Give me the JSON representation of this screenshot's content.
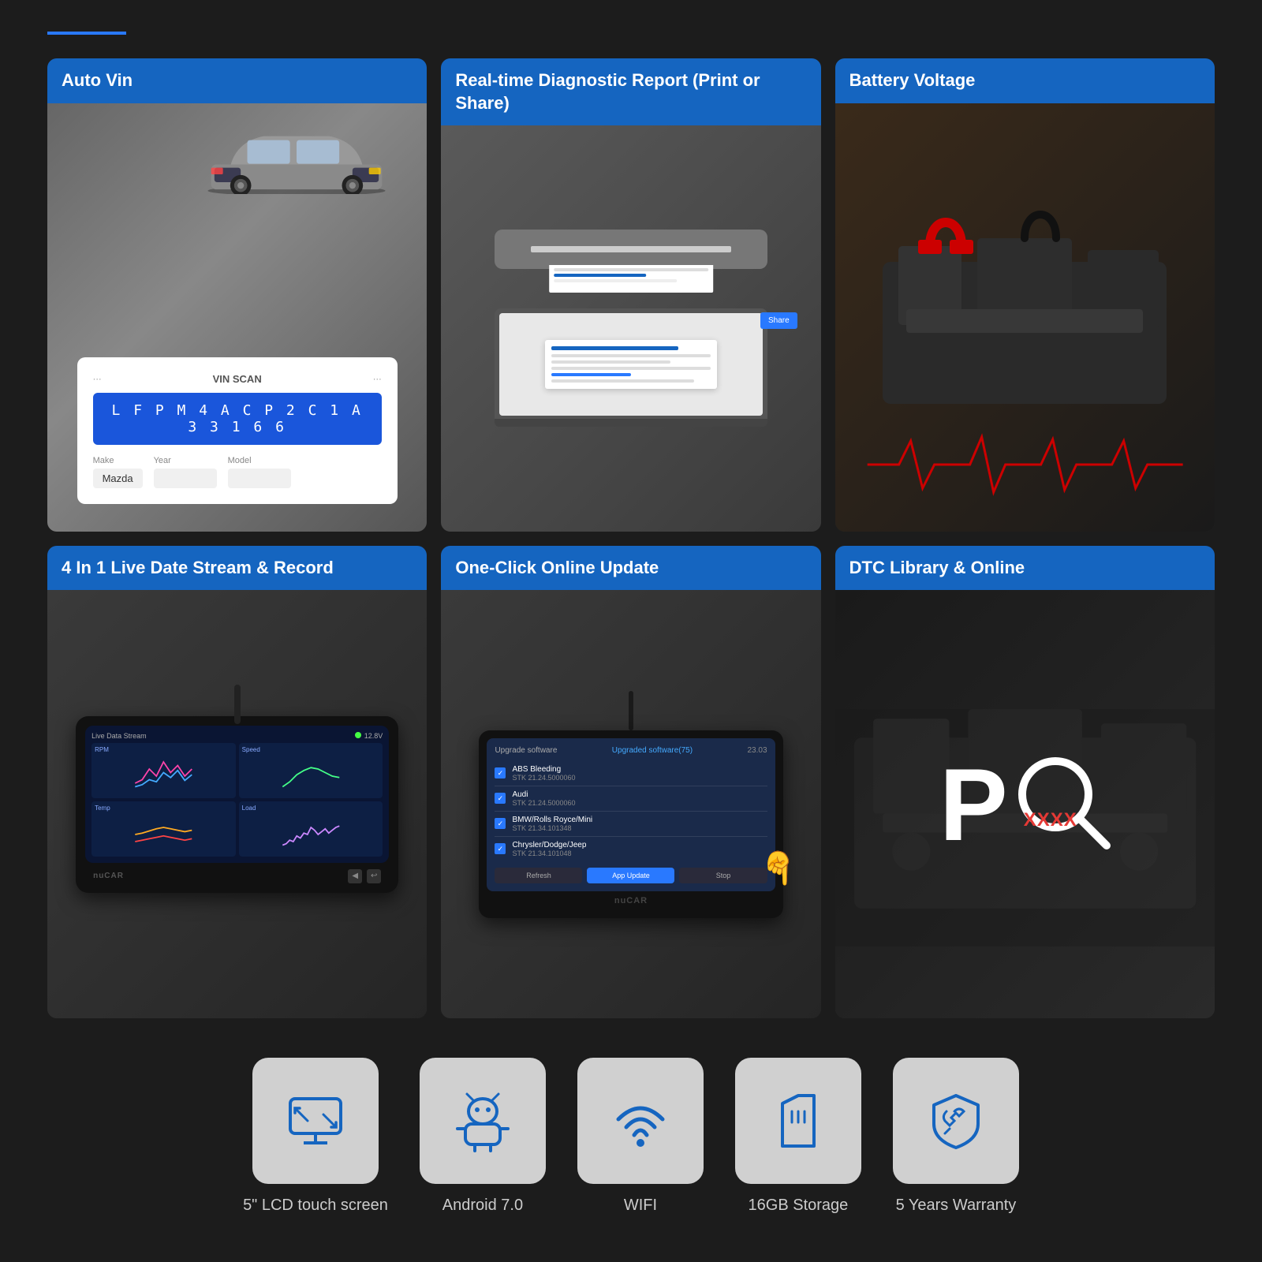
{
  "header": {
    "accent_line_color": "#2979ff"
  },
  "features_grid": {
    "cards": [
      {
        "id": "auto-vin",
        "label": "Auto Vin",
        "vin_code": "L F P M 4 A C P 2 C 1 A 3 3 1 6 6",
        "make_label": "Make",
        "year_label": "Year",
        "model_label": "Model",
        "make_value": "Mazda",
        "year_value": "",
        "model_value": ""
      },
      {
        "id": "diagnostic-report",
        "label": "Real-time Diagnostic Report (Print or Share)"
      },
      {
        "id": "battery-voltage",
        "label": "Battery Voltage"
      },
      {
        "id": "live-stream",
        "label": "4 In 1 Live Date Stream & Record"
      },
      {
        "id": "online-update",
        "label": "One-Click Online Update"
      },
      {
        "id": "dtc-library",
        "label": "DTC Library & Online",
        "dtc_p": "P",
        "dtc_code": "XXXX"
      }
    ]
  },
  "bottom_features": {
    "items": [
      {
        "id": "lcd-screen",
        "icon": "screen-icon",
        "label": "5\" LCD touch screen"
      },
      {
        "id": "android",
        "icon": "android-icon",
        "label": "Android 7.0"
      },
      {
        "id": "wifi",
        "icon": "wifi-icon",
        "label": "WIFI"
      },
      {
        "id": "storage",
        "icon": "storage-icon",
        "label": "16GB Storage"
      },
      {
        "id": "warranty",
        "icon": "warranty-icon",
        "label": "5 Years Warranty"
      }
    ]
  }
}
